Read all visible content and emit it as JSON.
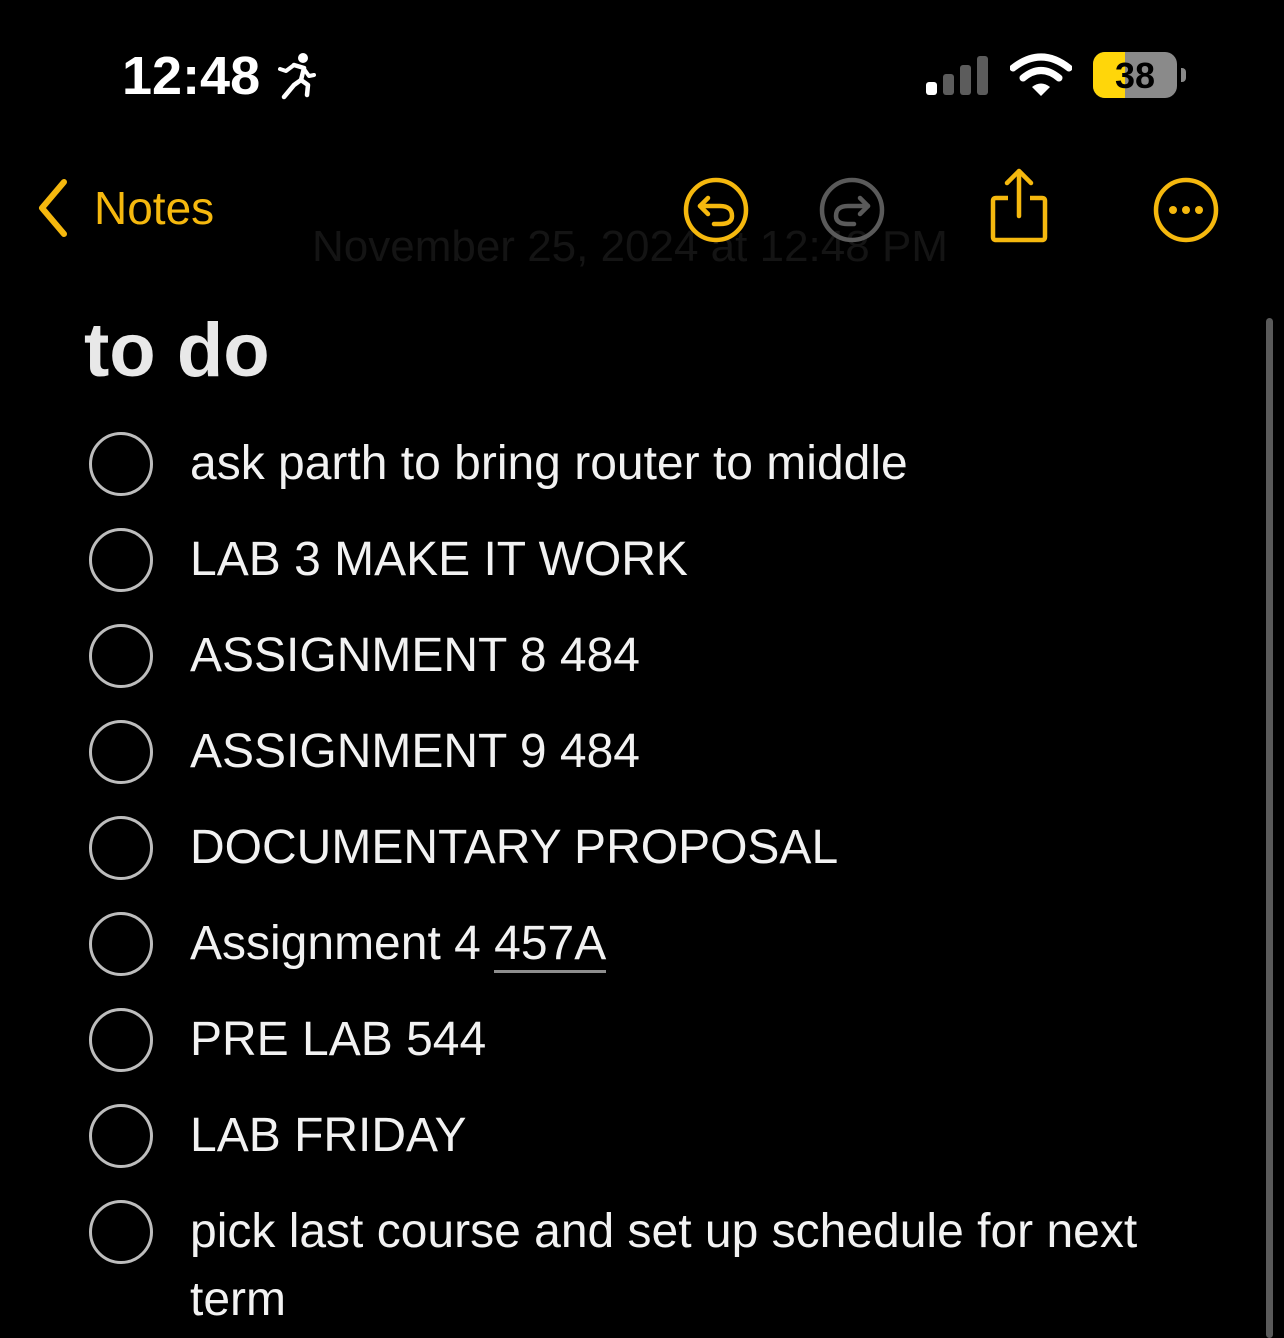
{
  "status_bar": {
    "time": "12:48",
    "activity_icon": "running-figure-icon",
    "signal_icon": "cellular-signal-icon",
    "signal_bars_active": 1,
    "wifi_icon": "wifi-icon",
    "battery_percent": "38",
    "battery_level": 0.38
  },
  "nav": {
    "back_label": "Notes",
    "back_icon": "chevron-left-icon",
    "undo_icon": "undo-icon",
    "redo_icon": "redo-icon",
    "share_icon": "share-icon",
    "more_icon": "more-icon",
    "date_text": "November 25, 2024 at 12:48 PM"
  },
  "note": {
    "title": "to do",
    "items": [
      {
        "text": "ask parth to bring router to middle",
        "checked": false
      },
      {
        "text": "LAB 3 MAKE IT WORK",
        "checked": false
      },
      {
        "text": "ASSIGNMENT 8 484",
        "checked": false
      },
      {
        "text": "ASSIGNMENT 9 484",
        "checked": false
      },
      {
        "text": "DOCUMENTARY PROPOSAL",
        "checked": false
      },
      {
        "text_prefix": "Assignment 4 ",
        "text_link": "457A",
        "checked": false
      },
      {
        "text": "PRE LAB 544",
        "checked": false
      },
      {
        "text": "LAB FRIDAY",
        "checked": false
      },
      {
        "text": "pick last course and set up schedule for next term",
        "checked": false
      }
    ]
  },
  "colors": {
    "accent": "#f5b80e",
    "background": "#000000",
    "text": "#f2f2f2",
    "checkbox_border": "#bdbdbd",
    "battery_fill": "#ffd60a"
  }
}
